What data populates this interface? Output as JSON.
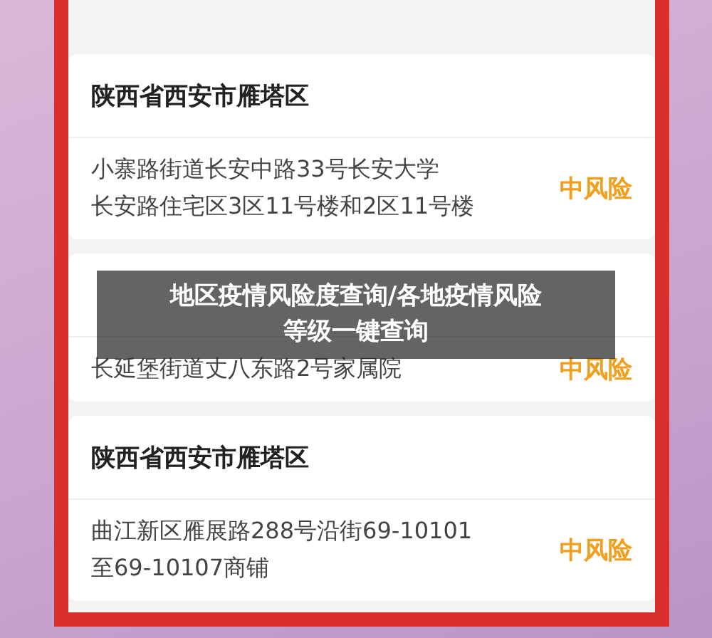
{
  "cards": [
    {
      "title": "陕西省西安市雁塔区",
      "address": [
        "小寨路街道长安中路33号长安大学",
        "长安路住宅区3区11号楼和2区11号楼"
      ],
      "risk": "中风险"
    },
    {
      "address": [
        "长延堡街道丈八东路2号家属院"
      ],
      "risk": "中风险"
    },
    {
      "title": "陕西省西安市雁塔区",
      "address": [
        "曲江新区雁展路288号沿街69-10101",
        "至69-10107商铺"
      ],
      "risk": "中风险"
    }
  ],
  "caption_overlay": [
    "地区疫情风险度查询/各地疫情风险",
    "等级一键查询"
  ]
}
